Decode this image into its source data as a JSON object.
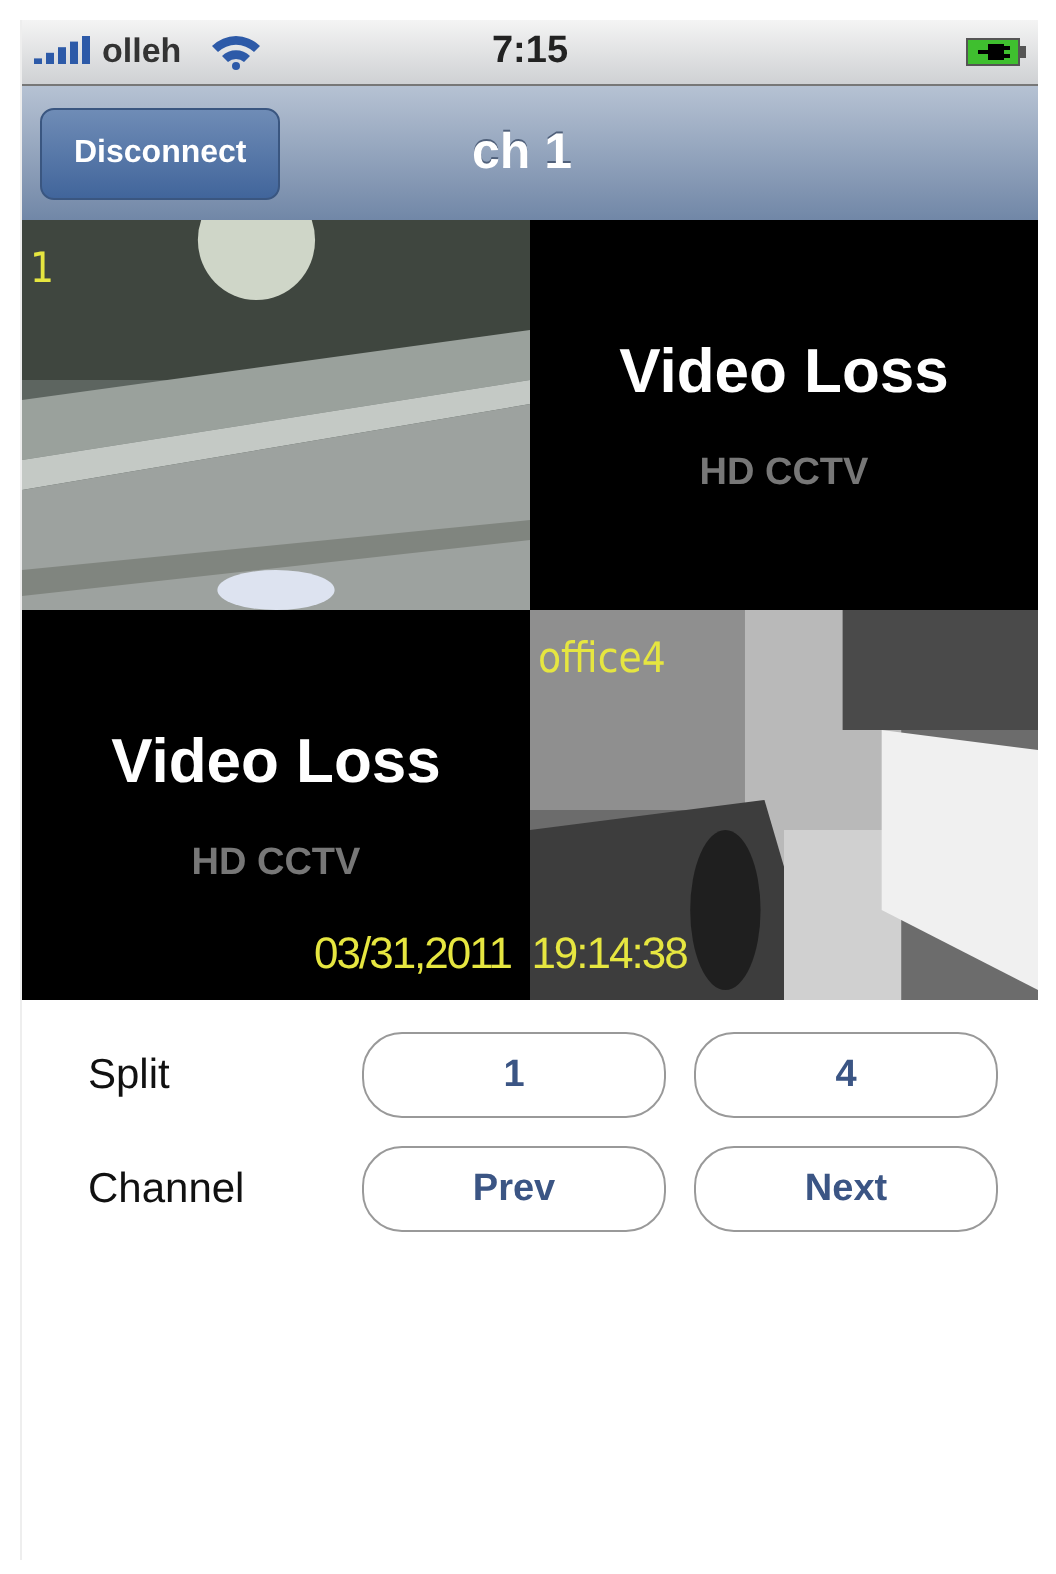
{
  "status_bar": {
    "carrier": "olleh",
    "time": "7:15"
  },
  "nav_bar": {
    "button": "Disconnect",
    "title": "ch 1"
  },
  "cameras": [
    {
      "kind": "road",
      "label": "1"
    },
    {
      "kind": "loss",
      "title": "Video Loss",
      "brand": "HD CCTV"
    },
    {
      "kind": "loss",
      "title": "Video Loss",
      "brand": "HD CCTV"
    },
    {
      "kind": "office",
      "label": "office4"
    }
  ],
  "timestamp": "03/31,2011  19:14:38",
  "controls": [
    {
      "label": "Split",
      "buttons": [
        "1",
        "4"
      ]
    },
    {
      "label": "Channel",
      "buttons": [
        "Prev",
        "Next"
      ]
    }
  ]
}
